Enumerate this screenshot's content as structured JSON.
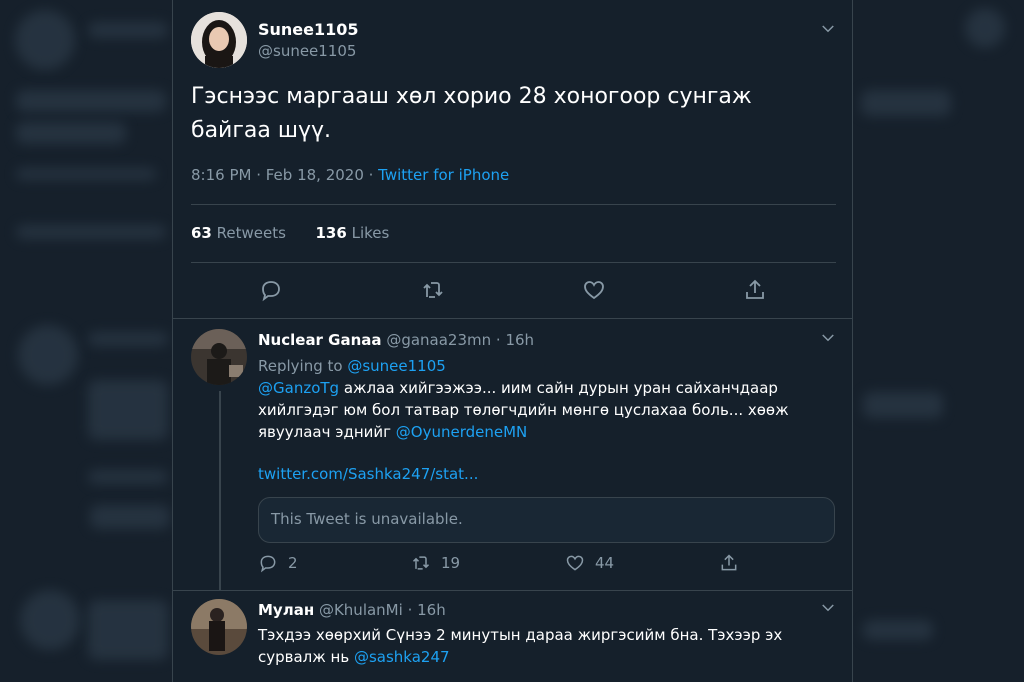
{
  "main_tweet": {
    "display_name": "Sunee1105",
    "handle": "@sunee1105",
    "text": "Гэснээс маргааш хөл хорио 28 хоногоор сунгаж байгаа шүү.",
    "time": "8:16 PM · Feb 18, 2020 · ",
    "source": "Twitter for iPhone",
    "retweets_count": "63",
    "retweets_label": "Retweets",
    "likes_count": "136",
    "likes_label": "Likes"
  },
  "replies": [
    {
      "display_name": "Nuclear Ganaa",
      "handle": "@ganaa23mn",
      "age": "16h",
      "replying_prefix": "Replying to ",
      "replying_to": "@sunee1105",
      "mention1": "@GanzoTg",
      "text1": " ажлаа хийгээжээ... иим сайн дурын уран сайханчдаар хийлгэдэг юм бол татвар төлөгчдийн мөнгө цуслахаа боль... хөөж явуулаач эднийг ",
      "mention2": "@OyunerdeneMN",
      "link": "twitter.com/Sashka247/stat...",
      "quote_unavailable": "This Tweet is unavailable.",
      "reply_count": "2",
      "retweet_count": "19",
      "like_count": "44"
    },
    {
      "display_name": "Мулан",
      "handle": "@KhulanMi",
      "age": "16h",
      "text": "Тэхдээ хөөрхий Сүнээ 2 минутын дараа жиргэсийм бна. Тэхээр эх сурвалж нь ",
      "mention": "@sashka247"
    }
  ],
  "separator": " · ",
  "colors": {
    "background": "#15202b",
    "accent": "#1da1f2",
    "muted": "#8899a6",
    "border": "#38444d"
  }
}
